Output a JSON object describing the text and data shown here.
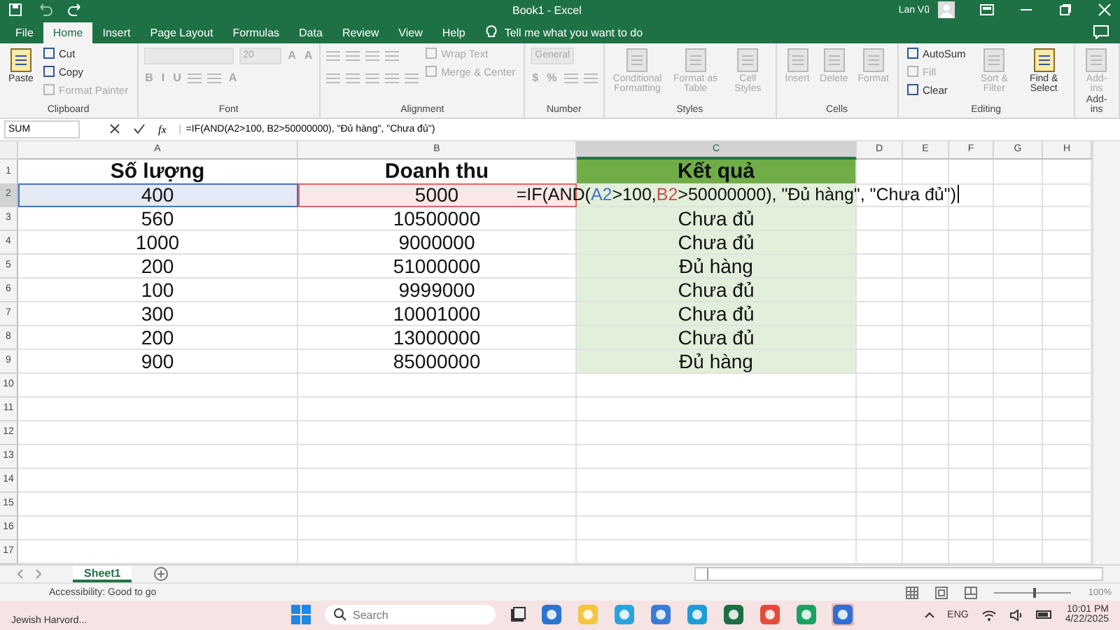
{
  "window": {
    "title": "Book1 - Excel",
    "user_name": "Lan Vũ"
  },
  "ribbon_tabs": [
    {
      "label": "File",
      "selected": false
    },
    {
      "label": "Home",
      "selected": true
    },
    {
      "label": "Insert",
      "selected": false
    },
    {
      "label": "Page Layout",
      "selected": false
    },
    {
      "label": "Formulas",
      "selected": false
    },
    {
      "label": "Data",
      "selected": false
    },
    {
      "label": "Review",
      "selected": false
    },
    {
      "label": "View",
      "selected": false
    },
    {
      "label": "Help",
      "selected": false
    }
  ],
  "tell_me": "Tell me what you want to do",
  "ribbon": [
    {
      "label": "Clipboard",
      "columns": [
        [
          {
            "kind": "large",
            "label": "Paste",
            "disabled": false
          }
        ],
        [
          {
            "kind": "small",
            "label": "Cut",
            "disabled": false
          },
          {
            "kind": "small",
            "label": "Copy",
            "disabled": false
          },
          {
            "kind": "small",
            "label": "Format Painter",
            "disabled": true
          }
        ]
      ]
    },
    {
      "label": "Font",
      "columns": [
        [
          {
            "kind": "row",
            "items": [
              {
                "kind": "field",
                "disabled": true
              },
              {
                "kind": "field",
                "label": "20",
                "disabled": true
              },
              {
                "kind": "glyph",
                "label": "A",
                "disabled": true
              },
              {
                "kind": "glyph",
                "label": "A",
                "disabled": true
              }
            ]
          },
          {
            "kind": "row",
            "items": [
              {
                "kind": "glyph",
                "label": "B",
                "disabled": true
              },
              {
                "kind": "glyph",
                "label": "I",
                "disabled": true
              },
              {
                "kind": "glyph",
                "label": "U",
                "disabled": true
              },
              {
                "kind": "icon",
                "disabled": true
              },
              {
                "kind": "icon",
                "disabled": true
              },
              {
                "kind": "glyph",
                "label": "A",
                "disabled": true
              }
            ]
          }
        ]
      ]
    },
    {
      "label": "Alignment",
      "columns": [
        [
          {
            "kind": "row",
            "items": [
              {
                "kind": "icon",
                "disabled": true
              },
              {
                "kind": "icon",
                "disabled": true
              },
              {
                "kind": "icon",
                "disabled": true
              },
              {
                "kind": "icon",
                "disabled": true
              }
            ]
          },
          {
            "kind": "row",
            "items": [
              {
                "kind": "icon",
                "disabled": true
              },
              {
                "kind": "icon",
                "disabled": true
              },
              {
                "kind": "icon",
                "disabled": true
              },
              {
                "kind": "icon",
                "disabled": true
              },
              {
                "kind": "icon",
                "disabled": true
              }
            ]
          }
        ],
        [
          {
            "kind": "small",
            "label": "Wrap Text",
            "disabled": true
          },
          {
            "kind": "small",
            "label": "Merge & Center",
            "disabled": true
          }
        ]
      ]
    },
    {
      "label": "Number",
      "columns": [
        [
          {
            "kind": "row",
            "items": [
              {
                "kind": "field",
                "label": "General",
                "disabled": true
              }
            ]
          },
          {
            "kind": "row",
            "items": [
              {
                "kind": "glyph",
                "label": "$",
                "disabled": true
              },
              {
                "kind": "glyph",
                "label": "%",
                "disabled": true
              },
              {
                "kind": "icon",
                "disabled": true
              },
              {
                "kind": "icon",
                "disabled": true
              }
            ]
          }
        ]
      ]
    },
    {
      "label": "Styles",
      "columns": [
        [
          {
            "kind": "large",
            "label": "Conditional Formatting",
            "disabled": true
          }
        ],
        [
          {
            "kind": "large",
            "label": "Format as Table",
            "disabled": true
          }
        ],
        [
          {
            "kind": "large",
            "label": "Cell Styles",
            "disabled": true
          }
        ]
      ]
    },
    {
      "label": "Cells",
      "columns": [
        [
          {
            "kind": "large",
            "label": "Insert",
            "disabled": true
          }
        ],
        [
          {
            "kind": "large",
            "label": "Delete",
            "disabled": true
          }
        ],
        [
          {
            "kind": "large",
            "label": "Format",
            "disabled": true
          }
        ]
      ]
    },
    {
      "label": "Editing",
      "columns": [
        [
          {
            "kind": "small",
            "label": "AutoSum",
            "disabled": false
          },
          {
            "kind": "small",
            "label": "Fill",
            "disabled": true
          },
          {
            "kind": "small",
            "label": "Clear",
            "disabled": false
          }
        ],
        [
          {
            "kind": "large",
            "label": "Sort & Filter",
            "disabled": true
          }
        ],
        [
          {
            "kind": "large",
            "label": "Find & Select",
            "disabled": false
          }
        ]
      ]
    },
    {
      "label": "Add-ins",
      "columns": [
        [
          {
            "kind": "large",
            "label": "Add-ins",
            "disabled": true
          }
        ]
      ]
    }
  ],
  "formula_bar": {
    "name_box": "SUM",
    "function_label": "fx",
    "formula": "=IF(AND(A2>100, B2>50000000), \"Đủ hàng\", \"Chưa đủ\")"
  },
  "sheet": {
    "columns": [
      {
        "label": "A",
        "selected": false
      },
      {
        "label": "B",
        "selected": false
      },
      {
        "label": "C",
        "selected": true
      },
      {
        "label": "D",
        "selected": false
      },
      {
        "label": "E",
        "selected": false
      },
      {
        "label": "F",
        "selected": false
      },
      {
        "label": "G",
        "selected": false
      },
      {
        "label": "H",
        "selected": false
      }
    ],
    "rows": [
      {
        "number": "1",
        "selected": false,
        "cells": [
          {
            "kind": "header",
            "text": "Số lượng"
          },
          {
            "kind": "header",
            "text": "Doanh thu"
          },
          {
            "kind": "header_result",
            "text": "Kết quả"
          }
        ]
      },
      {
        "number": "2",
        "selected": true,
        "cells": [
          {
            "kind": "value",
            "text": "400",
            "color": "#4472c4"
          },
          {
            "kind": "value",
            "text": "5000",
            "color": "#e06666"
          },
          {
            "kind": "editing",
            "segments": [
              {
                "text": "=IF(AND("
              },
              {
                "text": "A2",
                "color": "#4472c4"
              },
              {
                "text": ">100, "
              },
              {
                "text": "B2",
                "color": "#c0504d"
              },
              {
                "text": ">50000000), \"Đủ hàng\", \"Chưa đủ\")"
              }
            ]
          }
        ]
      },
      {
        "number": "3",
        "selected": false,
        "cells": [
          {
            "kind": "value",
            "text": "560"
          },
          {
            "kind": "value",
            "text": "10500000"
          },
          {
            "kind": "result",
            "text": "Chưa đủ"
          }
        ]
      },
      {
        "number": "4",
        "selected": false,
        "cells": [
          {
            "kind": "value",
            "text": "1000"
          },
          {
            "kind": "value",
            "text": "9000000"
          },
          {
            "kind": "result",
            "text": "Chưa đủ"
          }
        ]
      },
      {
        "number": "5",
        "selected": false,
        "cells": [
          {
            "kind": "value",
            "text": "200"
          },
          {
            "kind": "value",
            "text": "51000000"
          },
          {
            "kind": "result",
            "text": "Đủ hàng"
          }
        ]
      },
      {
        "number": "6",
        "selected": false,
        "cells": [
          {
            "kind": "value",
            "text": "100"
          },
          {
            "kind": "value",
            "text": "9999000"
          },
          {
            "kind": "result",
            "text": "Chưa đủ"
          }
        ]
      },
      {
        "number": "7",
        "selected": false,
        "cells": [
          {
            "kind": "value",
            "text": "300"
          },
          {
            "kind": "value",
            "text": "10001000"
          },
          {
            "kind": "result",
            "text": "Chưa đủ"
          }
        ]
      },
      {
        "number": "8",
        "selected": false,
        "cells": [
          {
            "kind": "value",
            "text": "200"
          },
          {
            "kind": "value",
            "text": "13000000"
          },
          {
            "kind": "result",
            "text": "Chưa đủ"
          }
        ]
      },
      {
        "number": "9",
        "selected": false,
        "cells": [
          {
            "kind": "value",
            "text": "900"
          },
          {
            "kind": "value",
            "text": "85000000"
          },
          {
            "kind": "result",
            "text": "Đủ hàng"
          }
        ]
      },
      {
        "number": "10",
        "selected": false
      },
      {
        "number": "11",
        "selected": false
      },
      {
        "number": "12",
        "selected": false
      },
      {
        "number": "13",
        "selected": false
      },
      {
        "number": "14",
        "selected": false
      },
      {
        "number": "15",
        "selected": false
      },
      {
        "number": "16",
        "selected": false
      },
      {
        "number": "17",
        "selected": false
      }
    ]
  },
  "sheet_tabs": [
    {
      "label": "Sheet1",
      "selected": true
    }
  ],
  "status_bar": {
    "text": "Accessibility: Good to go",
    "zoom": {
      "level": 0.5,
      "reading": "100%"
    }
  },
  "taskbar": {
    "weather": "Jewish Harvord...",
    "search_placeholder": "Search",
    "language": "ENG",
    "time": "10:01 PM",
    "date": "4/22/2025"
  }
}
